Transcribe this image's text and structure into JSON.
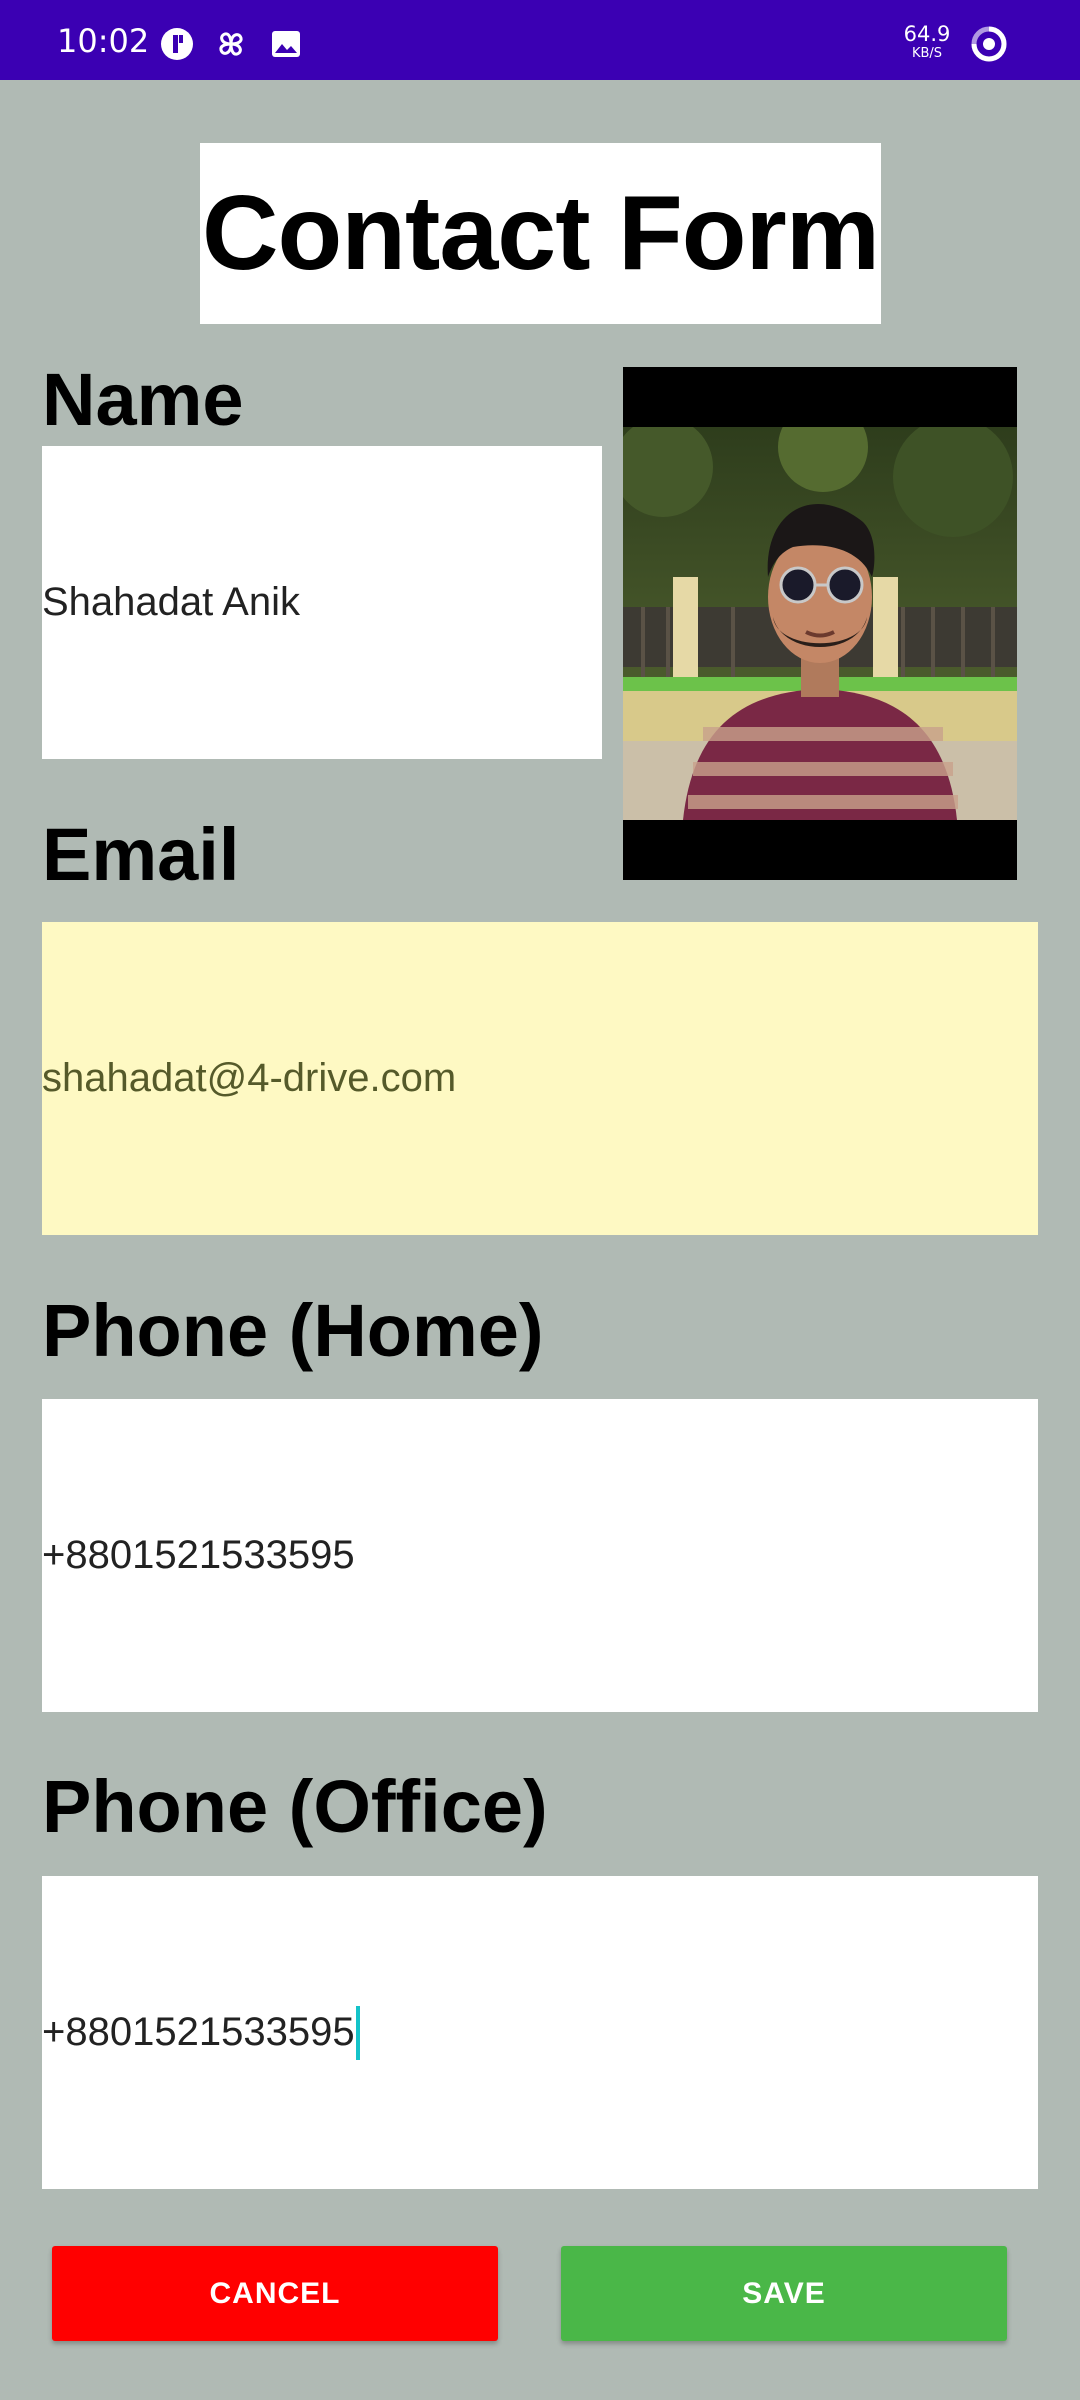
{
  "status_bar": {
    "time": "10:02",
    "net_speed_value": "64.9",
    "net_speed_unit": "KB/S",
    "icons": [
      "app-circle-icon",
      "pinwheel-icon",
      "gallery-icon",
      "data-saver-ring-icon"
    ]
  },
  "form": {
    "title": "Contact Form",
    "name_label": "Name",
    "name_value": "Shahadat Anik",
    "email_label": "Email",
    "email_value": "shahadat@4-drive.com",
    "phone_home_label": "Phone (Home)",
    "phone_home_value": "+8801521533595",
    "phone_office_label": "Phone (Office)",
    "phone_office_value": "+8801521533595"
  },
  "actions": {
    "cancel_label": "CANCEL",
    "save_label": "SAVE"
  },
  "colors": {
    "status_bar": "#3b00b3",
    "background": "#b0bab4",
    "email_field_autofill": "#fef9c3",
    "cancel": "#ff0000",
    "save": "#4ab748",
    "cursor": "#14c3c9"
  }
}
